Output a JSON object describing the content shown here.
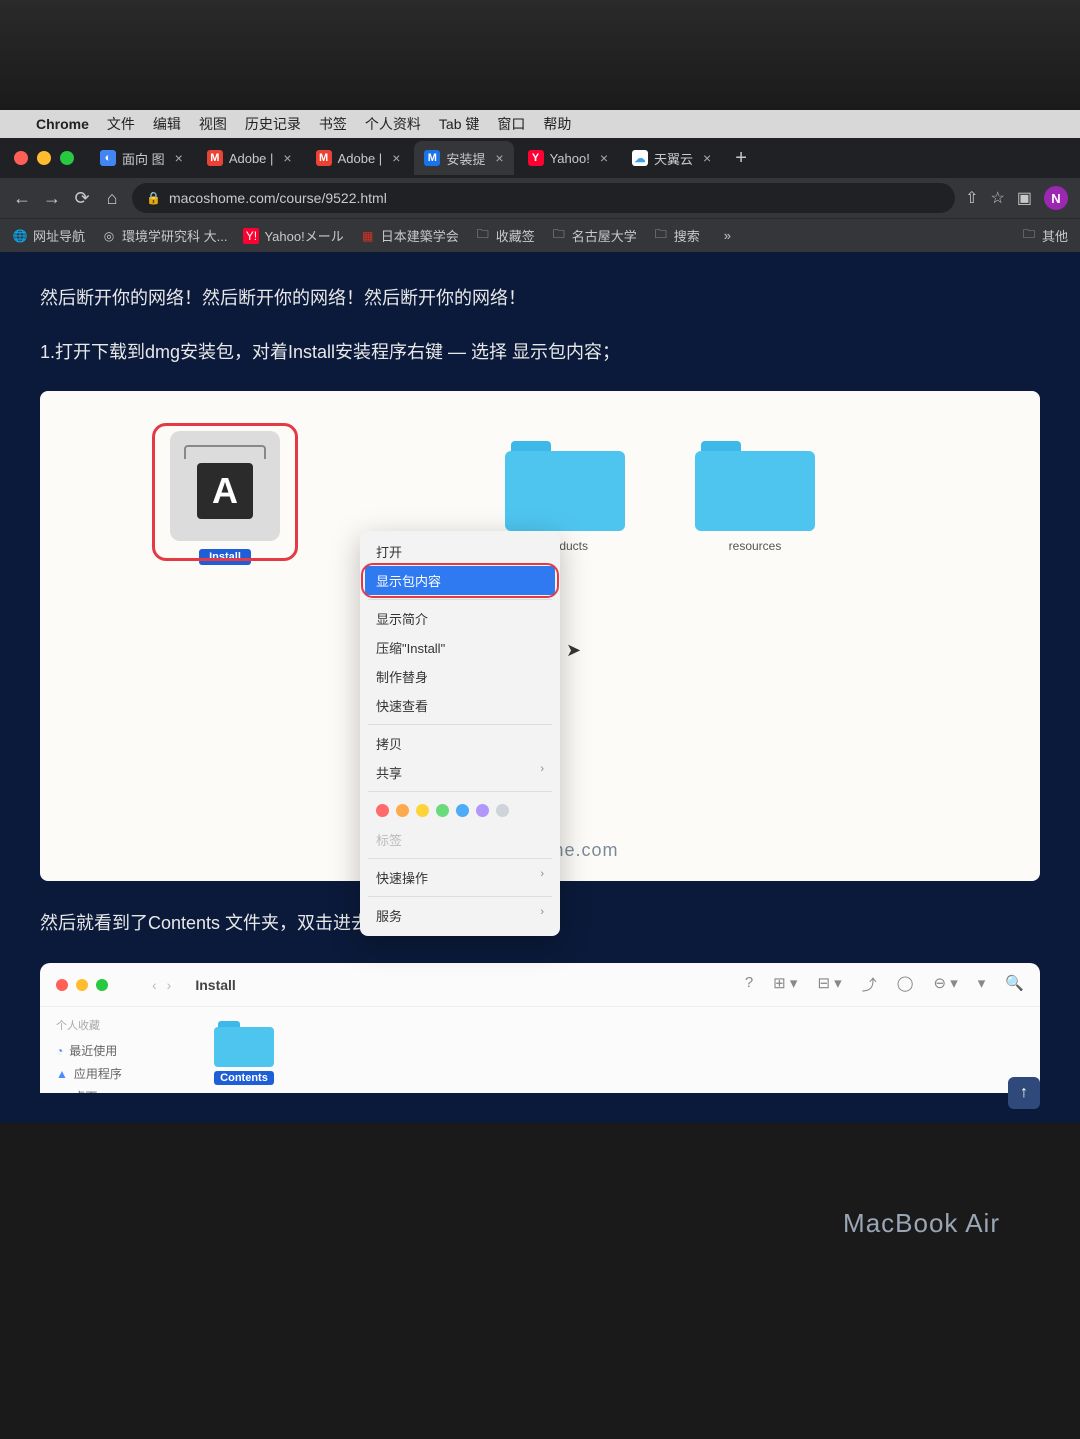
{
  "menubar": {
    "app": "Chrome",
    "items": [
      "文件",
      "编辑",
      "视图",
      "历史记录",
      "书签",
      "个人资料",
      "Tab 键",
      "窗口",
      "帮助"
    ]
  },
  "tabs": [
    {
      "label": "面向 图",
      "favicon_bg": "#4285f4",
      "favicon_text": "◐",
      "active": false
    },
    {
      "label": "Adobe |",
      "favicon_bg": "#ea4335",
      "favicon_text": "M",
      "active": false
    },
    {
      "label": "Adobe |",
      "favicon_bg": "#ea4335",
      "favicon_text": "M",
      "active": false
    },
    {
      "label": "安装提",
      "favicon_bg": "#1a73e8",
      "favicon_text": "M",
      "active": true
    },
    {
      "label": "Yahoo!",
      "favicon_bg": "#ff0033",
      "favicon_text": "Y",
      "active": false
    },
    {
      "label": "天翼云",
      "favicon_bg": "#ffffff",
      "favicon_text": "☁",
      "active": false
    }
  ],
  "url": "macoshome.com/course/9522.html",
  "profile_initial": "N",
  "bookmarks": [
    {
      "icon": "🌐",
      "label": "网址导航"
    },
    {
      "icon": "◎",
      "label": "環境学研究科  大..."
    },
    {
      "icon": "Y",
      "label": "Yahoo!メール",
      "icon_bg": "#ff0033"
    },
    {
      "icon": "▦",
      "label": "日本建築学会",
      "icon_bg": "#d93025"
    },
    {
      "icon": "📁",
      "label": "收藏签"
    },
    {
      "icon": "📁",
      "label": "名古屋大学"
    },
    {
      "icon": "📁",
      "label": "搜索"
    }
  ],
  "bookmarks_overflow": {
    "icon": "📁",
    "label": "其他"
  },
  "page": {
    "warning": "然后断开你的网络！然后断开你的网络！然后断开你的网络！",
    "step1": "1.打开下载到dmg安装包，对着Install安装程序右键 — 选择 显示包内容；",
    "step2": "然后就看到了Contents 文件夹，双击进去；"
  },
  "finder_icons": {
    "install": "Install",
    "products": "products",
    "resources": "resources"
  },
  "context_menu": {
    "open": "打开",
    "show_contents": "显示包内容",
    "get_info": "显示简介",
    "compress": "压缩\"Install\"",
    "make_alias": "制作替身",
    "quick_look": "快速查看",
    "copy": "拷贝",
    "share": "共享",
    "tags_label": "标签",
    "quick_actions": "快速操作",
    "services": "服务"
  },
  "tag_colors": [
    "#ff6b6b",
    "#ffa94d",
    "#ffd43b",
    "#69db7c",
    "#4dabf7",
    "#b197fc",
    "#ced4da"
  ],
  "watermark": "macOShome.com",
  "finder2": {
    "title": "Install",
    "sidebar_header": "个人收藏",
    "sidebar_items": [
      {
        "icon": "◔",
        "label": "最近使用",
        "color": "#4a8cff"
      },
      {
        "icon": "▲",
        "label": "应用程序",
        "color": "#4a8cff"
      },
      {
        "icon": "▭",
        "label": "桌面",
        "color": "#4a8cff"
      }
    ],
    "contents_label": "Contents"
  },
  "macbook": "MacBook Air"
}
